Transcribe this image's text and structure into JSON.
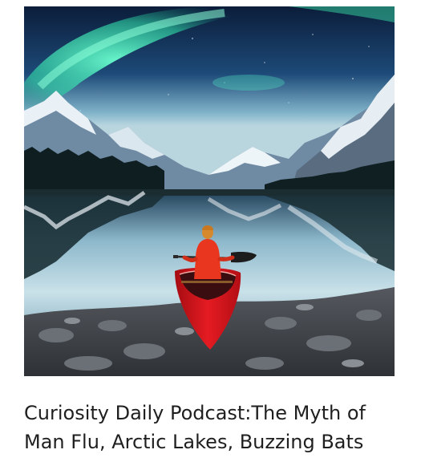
{
  "podcast_card": {
    "image_description_name": "aurora-lake-canoe-photo",
    "title_lines": [
      "Curiosity Daily Podcast:The Myth of",
      "Man Flu, Arctic Lakes, Buzzing Bats"
    ]
  },
  "colors": {
    "title_text": "#1f1f1f",
    "aurora": "#3ff0b0",
    "sky_dark": "#0f2a4a",
    "lake": "#9fc7d8",
    "jacket": "#e8361f",
    "canoe": "#d7141c",
    "rocks": "#4b4f55"
  }
}
